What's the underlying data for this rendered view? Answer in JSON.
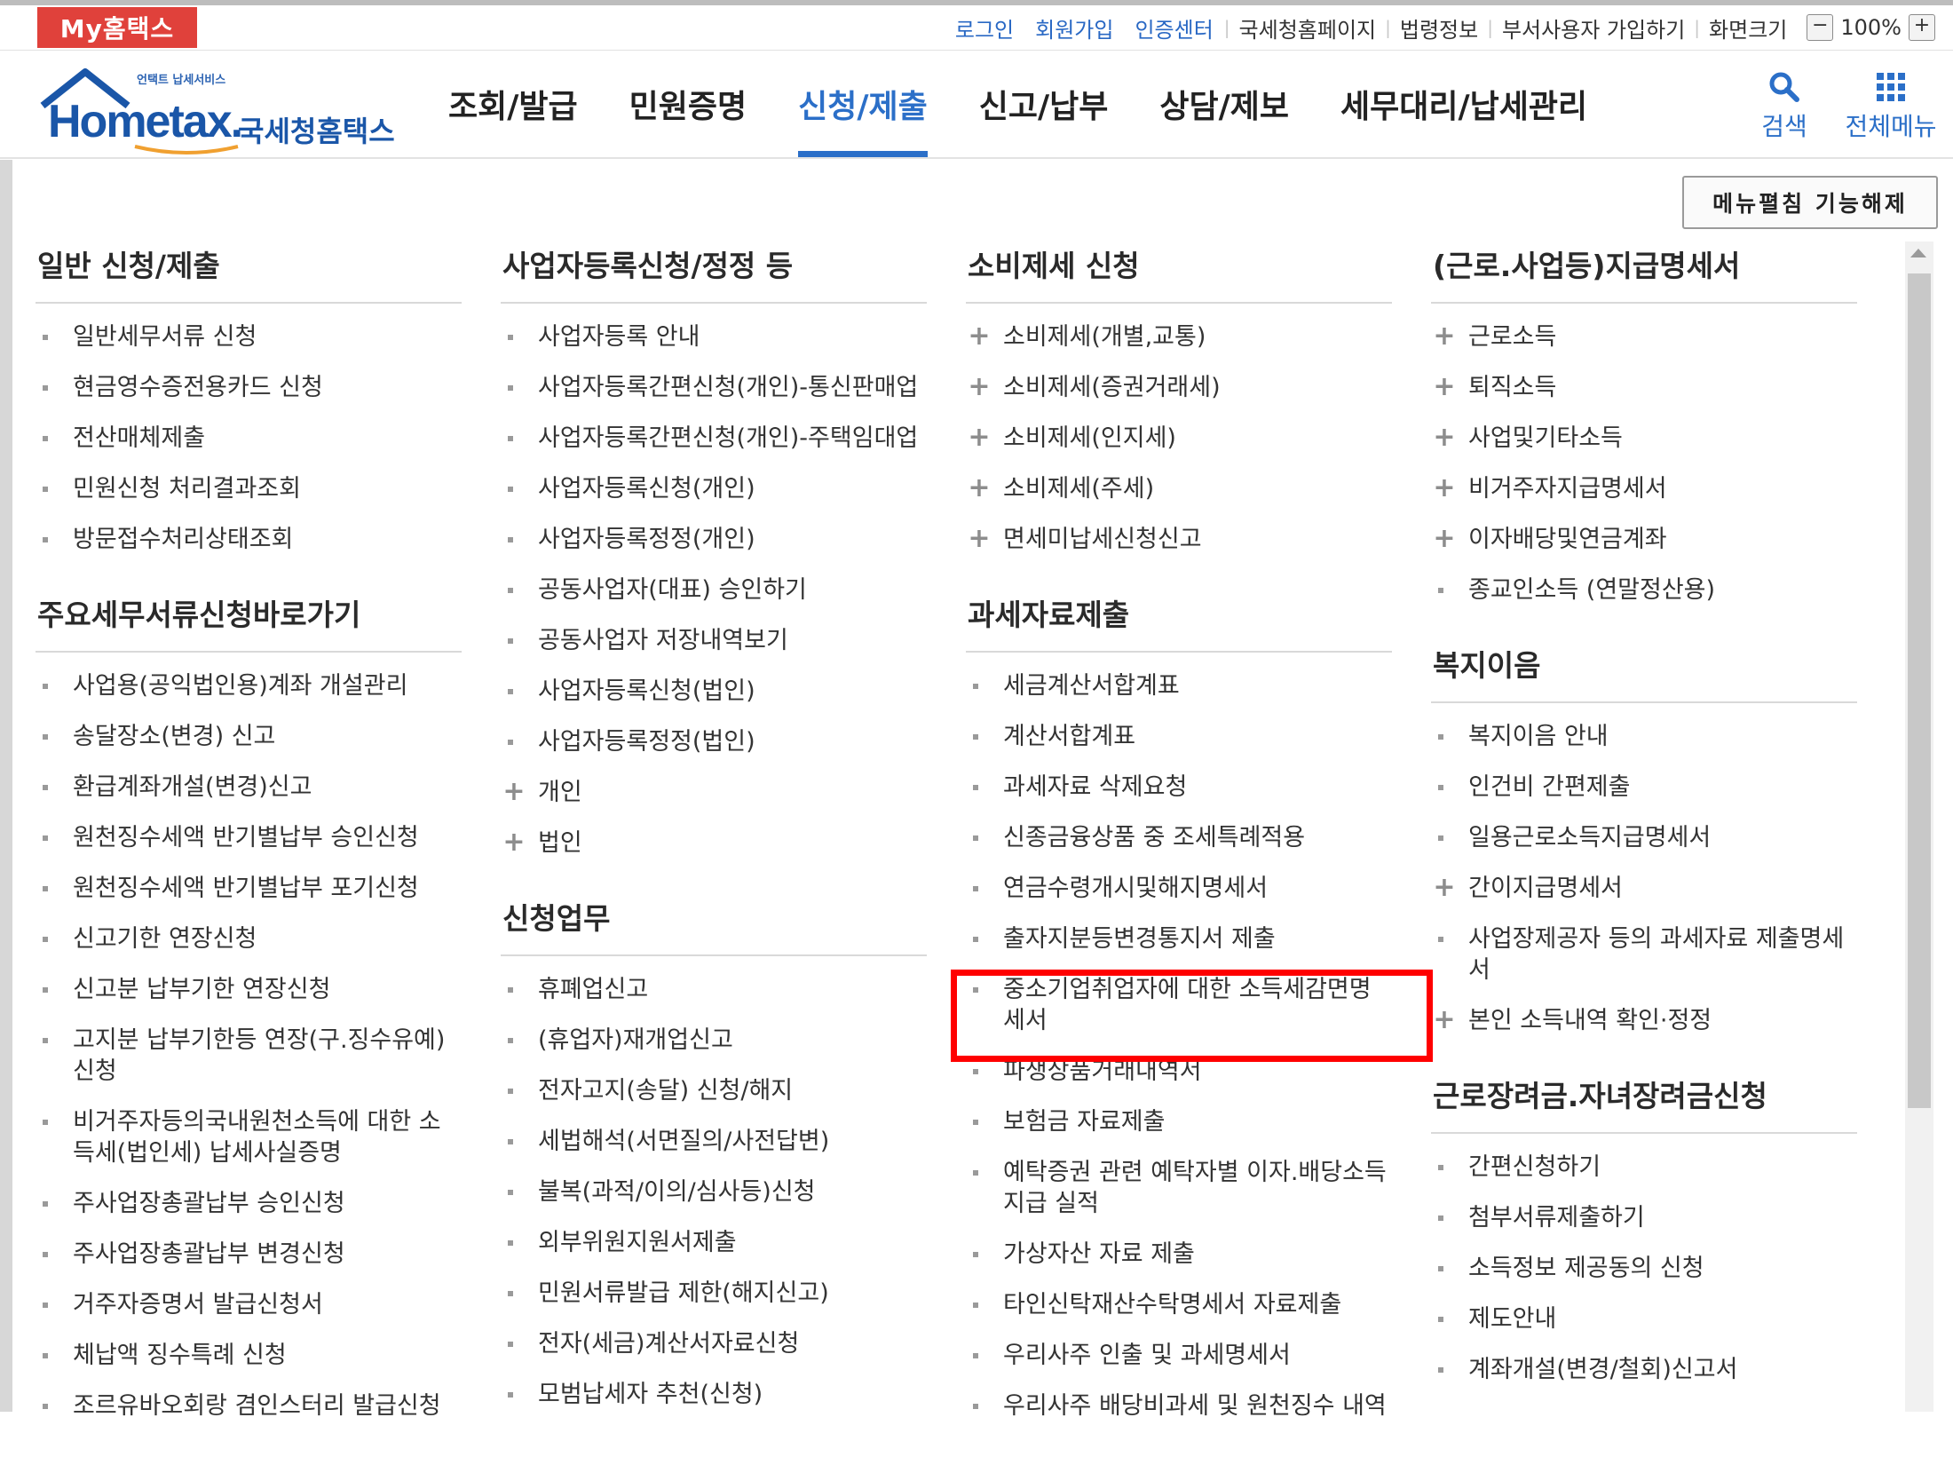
{
  "topbar": {
    "mytax": "My홈택스",
    "links": [
      "로그인",
      "회원가입",
      "인증센터"
    ],
    "plain": [
      "국세청홈페이지",
      "법령정보",
      "부서사용자 가입하기",
      "화면크기"
    ],
    "zoom_minus": "−",
    "zoom_value": "100%",
    "zoom_plus": "+"
  },
  "header": {
    "logo_small": "언택트 납세서비스",
    "logo_main": "Hometax.",
    "logo_kor": "국세청홈택스",
    "gnb": [
      "조회/발급",
      "민원증명",
      "신청/제출",
      "신고/납부",
      "상담/제보",
      "세무대리/납세관리"
    ],
    "search_label": "검색",
    "allmenu_label": "전체메뉴"
  },
  "fold_button": "메뉴펼침 기능해제",
  "col1": {
    "s1_title": "일반 신청/제출",
    "s1_items": [
      "일반세무서류 신청",
      "현금영수증전용카드 신청",
      "전산매체제출",
      "민원신청 처리결과조회",
      "방문접수처리상태조회"
    ],
    "s2_title": "주요세무서류신청바로가기",
    "s2_items": [
      "사업용(공익법인용)계좌 개설관리",
      "송달장소(변경) 신고",
      "환급계좌개설(변경)신고",
      "원천징수세액 반기별납부 승인신청",
      "원천징수세액 반기별납부 포기신청",
      "신고기한 연장신청",
      "신고분 납부기한 연장신청",
      "고지분 납부기한등 연장(구.징수유예)신청",
      "비거주자등의국내원천소득에 대한 소득세(법인세) 납세사실증명",
      "주사업장총괄납부 승인신청",
      "주사업장총괄납부 변경신청",
      "거주자증명서 발급신청서",
      "체납액 징수특례 신청",
      "조르유바오회랑 겸인스터리 발급신청"
    ]
  },
  "col2": {
    "s1_title": "사업자등록신청/정정 등",
    "s1_items": [
      "사업자등록 안내",
      "사업자등록간편신청(개인)-통신판매업",
      "사업자등록간편신청(개인)-주택임대업",
      "사업자등록신청(개인)",
      "사업자등록정정(개인)",
      "공동사업자(대표) 승인하기",
      "공동사업자 저장내역보기",
      "사업자등록신청(법인)",
      "사업자등록정정(법인)",
      "개인",
      "법인"
    ],
    "s2_title": "신청업무",
    "s2_items": [
      "휴폐업신고",
      "(휴업자)재개업신고",
      "전자고지(송달) 신청/해지",
      "세법해석(서면질의/사전답변)",
      "불복(과적/이의/심사등)신청",
      "외부위원지원서제출",
      "민원서류발급 제한(해지신고)",
      "전자(세금)계산서자료신청",
      "모범납세자 추천(신청)"
    ]
  },
  "col3": {
    "s1_title": "소비제세 신청",
    "s1_items": [
      "소비제세(개별,교통)",
      "소비제세(증권거래세)",
      "소비제세(인지세)",
      "소비제세(주세)",
      "면세미납세신청신고"
    ],
    "s2_title": "과세자료제출",
    "s2_items": [
      "세금계산서합계표",
      "계산서합계표",
      "과세자료 삭제요청",
      "신종금융상품 중 조세특례적용",
      "연금수령개시및해지명세서",
      "출자지분등변경통지서 제출",
      "중소기업취업자에 대한 소득세감면명세서",
      "파생상품거래내역서",
      "보험금 자료제출",
      "예탁증권 관련 예탁자별 이자.배당소득 지급 실적",
      "가상자산 자료 제출",
      "타인신탁재산수탁명세서 자료제출",
      "우리사주 인출 및 과세명세서",
      "우리사주 배당비과세 및 원천징수 내역"
    ]
  },
  "col4": {
    "s1_title": "(근로.사업등)지급명세서",
    "s1_items": [
      "근로소득",
      "퇴직소득",
      "사업및기타소득",
      "비거주자지급명세서",
      "이자배당및연금계좌",
      "종교인소득 (연말정산용)"
    ],
    "s2_title": "복지이음",
    "s2_items": [
      "복지이음 안내",
      "인건비 간편제출",
      "일용근로소득지급명세서",
      "간이지급명세서",
      "사업장제공자 등의 과세자료 제출명세서",
      "본인 소득내역 확인·정정"
    ],
    "s3_title": "근로장려금.자녀장려금신청",
    "s3_items": [
      "간편신청하기",
      "첨부서류제출하기",
      "소득정보 제공동의 신청",
      "제도안내",
      "계좌개설(변경/철회)신고서"
    ]
  }
}
